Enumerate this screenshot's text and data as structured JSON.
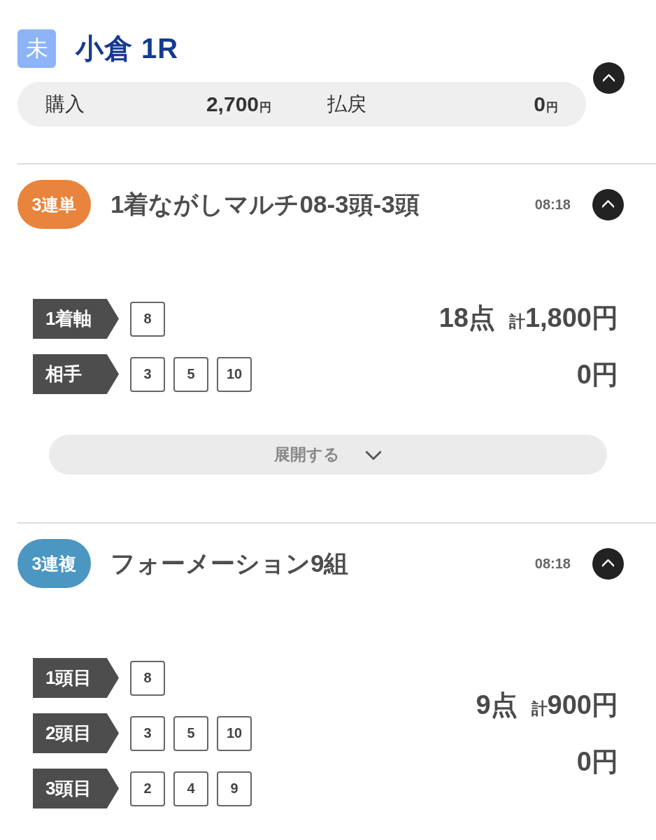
{
  "race": {
    "status_badge": "未",
    "title": "小倉 1R",
    "expanded": true
  },
  "summary": {
    "purchase_label": "購入",
    "purchase_amount": "2,700",
    "purchase_unit": "円",
    "payout_label": "払戻",
    "payout_amount": "0",
    "payout_unit": "円"
  },
  "bets": [
    {
      "type_badge": "3連単",
      "color": "#e8843c",
      "title": "1着ながしマルチ08-3頭-3頭",
      "time": "08:18",
      "expanded": true,
      "rows": [
        {
          "label": "1着軸",
          "numbers": [
            "8"
          ]
        },
        {
          "label": "相手",
          "numbers": [
            "3",
            "5",
            "10"
          ]
        }
      ],
      "points": "18点",
      "total_label": "計",
      "total_amount": "1,800円",
      "payout": "0円",
      "expand_button": "展開する"
    },
    {
      "type_badge": "3連複",
      "color": "#4b97c2",
      "title": "フォーメーション9組",
      "time": "08:18",
      "expanded": true,
      "rows": [
        {
          "label": "1頭目",
          "numbers": [
            "8"
          ]
        },
        {
          "label": "2頭目",
          "numbers": [
            "3",
            "5",
            "10"
          ]
        },
        {
          "label": "3頭目",
          "numbers": [
            "2",
            "4",
            "9"
          ]
        }
      ],
      "points": "9点",
      "total_label": "計",
      "total_amount": "900円",
      "payout": "0円"
    }
  ]
}
